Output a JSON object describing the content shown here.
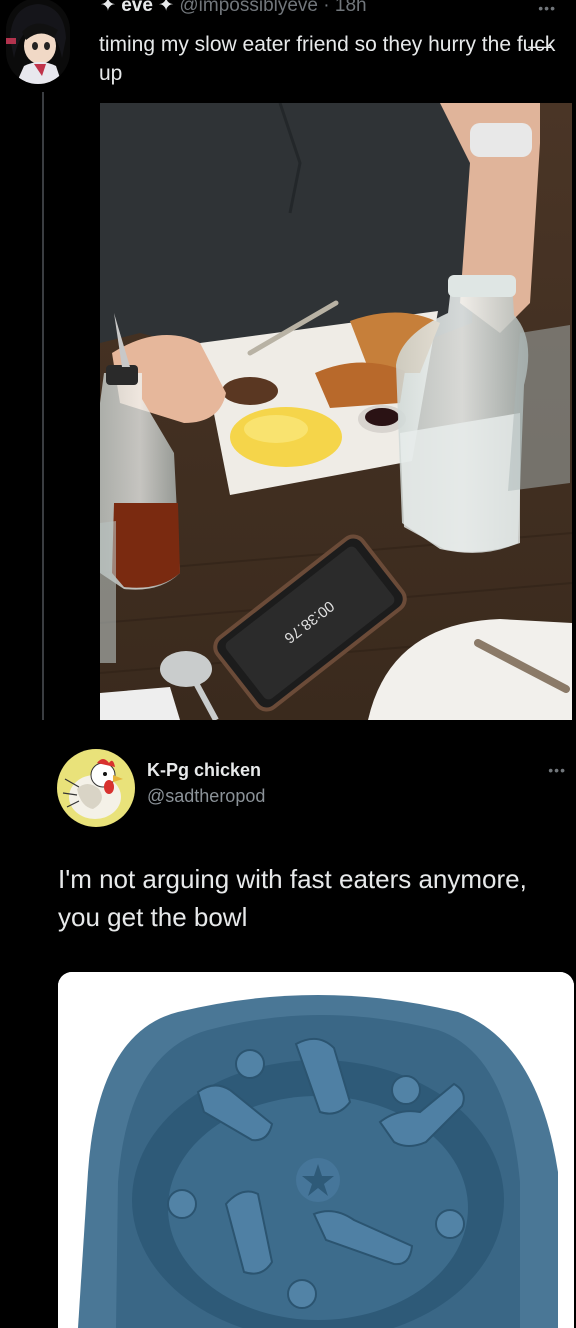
{
  "tweet1": {
    "display_name": "✦ eve ✦",
    "handle": "@impossiblyeve",
    "separator": "·",
    "time": "18h",
    "more": "•••",
    "text": "timing my slow eater friend so they hurry the fu̶c̶k up",
    "phone_timer": "00:38.76"
  },
  "tweet2": {
    "display_name": "K-Pg chicken",
    "handle": "@sadtheropod",
    "more": "•••",
    "text": "I'm not arguing with fast eaters anymore, you get the bowl"
  },
  "colors": {
    "background": "#000000",
    "text_primary": "#e7e9ea",
    "text_secondary": "#71767b",
    "bowl_blue": "#3f6f8f"
  }
}
